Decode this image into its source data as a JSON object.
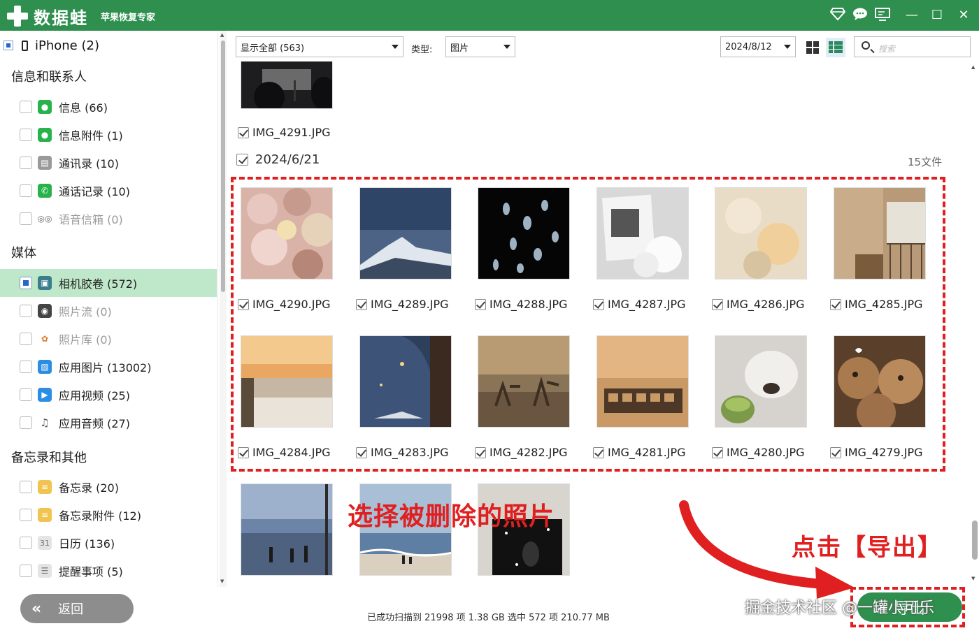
{
  "titlebar": {
    "app_name": "数据蛙",
    "app_subtitle": "苹果恢复专家",
    "icons": [
      "diamond-icon",
      "chat-icon",
      "screen-icon",
      "minimize-icon",
      "maximize-icon",
      "close-icon"
    ],
    "minimize": "—",
    "maximize": "☐",
    "close": "✕"
  },
  "sidebar": {
    "device_label": "iPhone (2)",
    "group_messages": "信息和联系人",
    "group_media": "媒体",
    "group_notes": "备忘录和其他",
    "items": [
      {
        "label": "信息 (66)",
        "icon": "message-icon"
      },
      {
        "label": "信息附件 (1)",
        "icon": "message-attachment-icon"
      },
      {
        "label": "通讯录 (10)",
        "icon": "contacts-icon"
      },
      {
        "label": "通话记录 (10)",
        "icon": "phone-icon"
      },
      {
        "label": "语音信箱 (0)",
        "icon": "voicemail-icon"
      },
      {
        "label": "相机胶卷 (572)",
        "icon": "camera-roll-icon"
      },
      {
        "label": "照片流 (0)",
        "icon": "photo-stream-icon"
      },
      {
        "label": "照片库 (0)",
        "icon": "photo-library-icon"
      },
      {
        "label": "应用图片 (13002)",
        "icon": "app-photos-icon"
      },
      {
        "label": "应用视频 (25)",
        "icon": "app-videos-icon"
      },
      {
        "label": "应用音频 (27)",
        "icon": "app-audio-icon"
      },
      {
        "label": "备忘录 (20)",
        "icon": "notes-icon"
      },
      {
        "label": "备忘录附件 (12)",
        "icon": "notes-attachment-icon"
      },
      {
        "label": "日历 (136)",
        "icon": "calendar-icon"
      },
      {
        "label": "提醒事项 (5)",
        "icon": "reminders-icon"
      }
    ],
    "back_label": "返回"
  },
  "toolbar": {
    "filter_value": "显示全部 (563)",
    "type_label": "类型:",
    "type_value": "图片",
    "date_value": "2024/8/12",
    "search_placeholder": "搜索"
  },
  "content": {
    "prev_caption": "IMG_4291.JPG",
    "date_group": "2024/6/21",
    "file_count": "15文件",
    "photos": [
      {
        "name": "IMG_4290.JPG"
      },
      {
        "name": "IMG_4289.JPG"
      },
      {
        "name": "IMG_4288.JPG"
      },
      {
        "name": "IMG_4287.JPG"
      },
      {
        "name": "IMG_4286.JPG"
      },
      {
        "name": "IMG_4285.JPG"
      },
      {
        "name": "IMG_4284.JPG"
      },
      {
        "name": "IMG_4283.JPG"
      },
      {
        "name": "IMG_4282.JPG"
      },
      {
        "name": "IMG_4281.JPG"
      },
      {
        "name": "IMG_4280.JPG"
      },
      {
        "name": "IMG_4279.JPG"
      }
    ]
  },
  "annotations": {
    "select_hint": "选择被删除的照片",
    "export_hint": "点击【导出】"
  },
  "footer": {
    "status": "已成功扫描到 21998 项 1.38 GB  选中 572 项 210.77 MB",
    "export_label": "导出",
    "watermark": "掘金技术社区 @一罐小可乐"
  },
  "colors": {
    "brand_green": "#2f8f4e",
    "active_row": "#bfe7c9",
    "annotation_red": "#e02020"
  }
}
